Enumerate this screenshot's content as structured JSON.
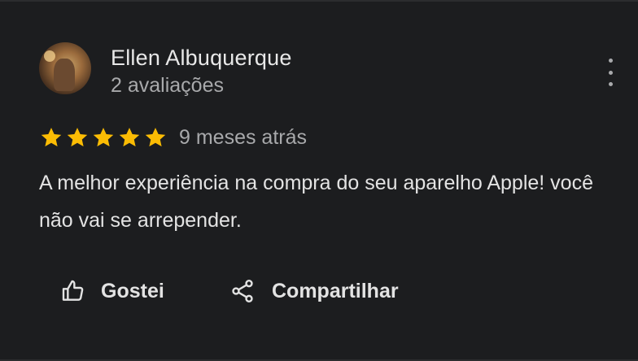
{
  "review": {
    "author_name": "Ellen Albuquerque",
    "author_reviews": "2 avaliações",
    "rating": 5,
    "rating_max": 5,
    "time_ago": "9 meses atrás",
    "text": "A melhor experiência na compra do seu aparelho Apple! você não vai se arrepender.",
    "star_color": "#fbbc04"
  },
  "actions": {
    "like_label": "Gostei",
    "share_label": "Compartilhar"
  },
  "icons": {
    "more": "more-vert-icon",
    "like": "thumb-up-icon",
    "share": "share-icon",
    "star": "star-icon"
  }
}
